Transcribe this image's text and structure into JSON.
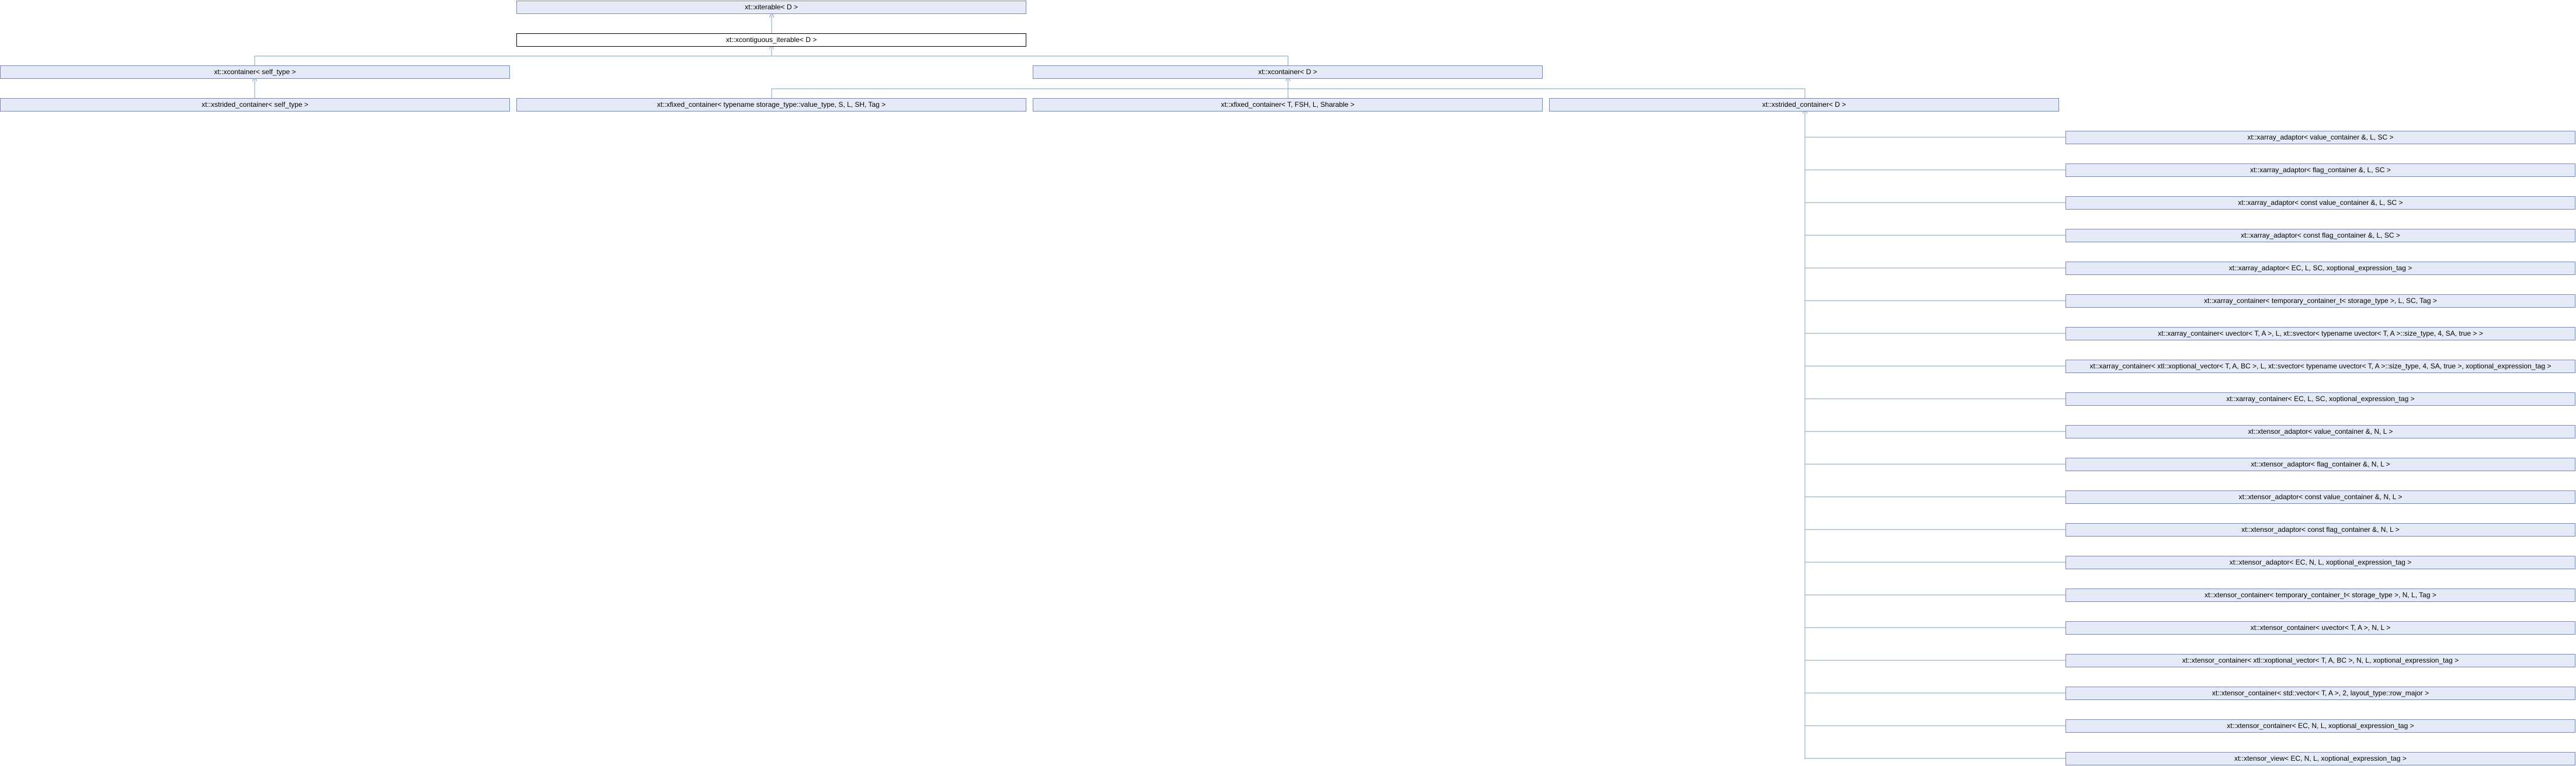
{
  "diagram": {
    "colors": {
      "node_fill": "#e6eaf6",
      "node_border": "#7a87b3",
      "edge": "#7da0c9",
      "current_border": "#000000"
    },
    "nodes": [
      {
        "id": "iterable",
        "label": "xt::xiterable< D >"
      },
      {
        "id": "contiguous",
        "label": "xt::xcontiguous_iterable< D >"
      },
      {
        "id": "container_self",
        "label": "xt::xcontainer< self_type >"
      },
      {
        "id": "container_d",
        "label": "xt::xcontainer< D >"
      },
      {
        "id": "strided_self",
        "label": "xt::xstrided_container< self_type >"
      },
      {
        "id": "fixed_storage",
        "label": "xt::xfixed_container< typename storage_type::value_type, S, L, SH, Tag >"
      },
      {
        "id": "fixed_t",
        "label": "xt::xfixed_container< T, FSH, L, Sharable >"
      },
      {
        "id": "strided_d",
        "label": "xt::xstrided_container< D >"
      },
      {
        "id": "c0",
        "label": "xt::xarray_adaptor< value_container &, L, SC >"
      },
      {
        "id": "c1",
        "label": "xt::xarray_adaptor< flag_container &, L, SC >"
      },
      {
        "id": "c2",
        "label": "xt::xarray_adaptor< const value_container &, L, SC >"
      },
      {
        "id": "c3",
        "label": "xt::xarray_adaptor< const flag_container &, L, SC >"
      },
      {
        "id": "c4",
        "label": "xt::xarray_adaptor< EC, L, SC, xoptional_expression_tag >"
      },
      {
        "id": "c5",
        "label": "xt::xarray_container< temporary_container_t< storage_type >, L, SC, Tag >"
      },
      {
        "id": "c6",
        "label": "xt::xarray_container< uvector< T, A >, L, xt::svector< typename uvector< T, A >::size_type, 4, SA, true > >"
      },
      {
        "id": "c7",
        "label": "xt::xarray_container< xtl::xoptional_vector< T, A, BC >, L, xt::svector< typename uvector< T, A >::size_type, 4, SA, true >, xoptional_expression_tag >"
      },
      {
        "id": "c8",
        "label": "xt::xarray_container< EC, L, SC, xoptional_expression_tag >"
      },
      {
        "id": "c9",
        "label": "xt::xtensor_adaptor< value_container &, N, L >"
      },
      {
        "id": "c10",
        "label": "xt::xtensor_adaptor< flag_container &, N, L >"
      },
      {
        "id": "c11",
        "label": "xt::xtensor_adaptor< const value_container &, N, L >"
      },
      {
        "id": "c12",
        "label": "xt::xtensor_adaptor< const flag_container &, N, L >"
      },
      {
        "id": "c13",
        "label": "xt::xtensor_adaptor< EC, N, L, xoptional_expression_tag >"
      },
      {
        "id": "c14",
        "label": "xt::xtensor_container< temporary_container_t< storage_type >, N, L, Tag >"
      },
      {
        "id": "c15",
        "label": "xt::xtensor_container< uvector< T, A >, N, L >"
      },
      {
        "id": "c16",
        "label": "xt::xtensor_container< xtl::xoptional_vector< T, A, BC >, N, L, xoptional_expression_tag >"
      },
      {
        "id": "c17",
        "label": "xt::xtensor_container< std::vector< T, A >, 2, layout_type::row_major >"
      },
      {
        "id": "c18",
        "label": "xt::xtensor_container< EC, N, L, xoptional_expression_tag >"
      },
      {
        "id": "c19",
        "label": "xt::xtensor_view< EC, N, L, xoptional_expression_tag >"
      }
    ]
  }
}
